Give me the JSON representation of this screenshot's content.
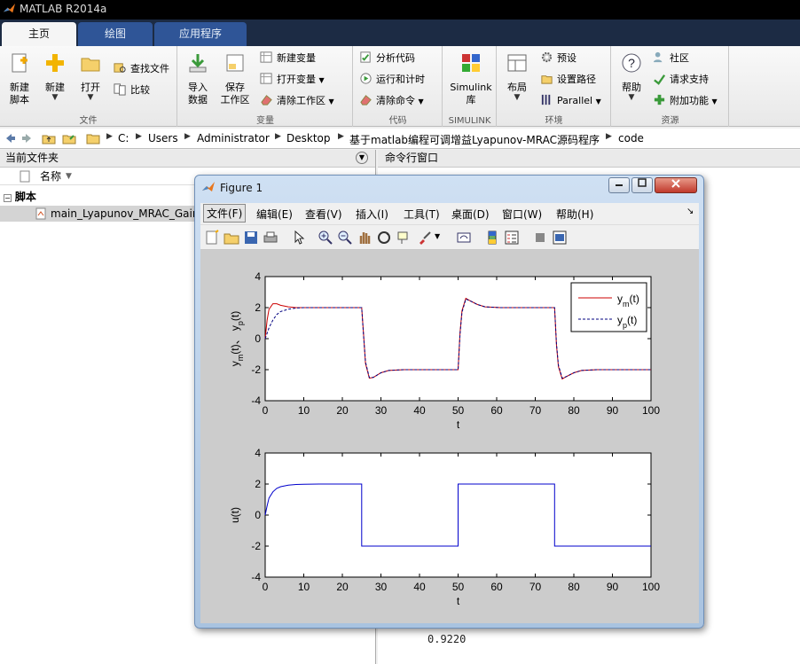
{
  "app": {
    "title": "MATLAB R2014a",
    "tabs": [
      {
        "label": "主页",
        "active": true
      },
      {
        "label": "绘图",
        "active": false
      },
      {
        "label": "应用程序",
        "active": false
      }
    ]
  },
  "ribbon": {
    "file": {
      "group_label": "文件",
      "new_script_line1": "新建",
      "new_script_line2": "脚本",
      "new_label": "新建",
      "open_label": "打开",
      "find_files": "查找文件",
      "compare": "比较"
    },
    "variable": {
      "group_label": "变量",
      "import_line1": "导入",
      "import_line2": "数据",
      "save_line1": "保存",
      "save_line2": "工作区",
      "new_variable": "新建变量",
      "open_variable": "打开变量",
      "clear_workspace": "清除工作区"
    },
    "code": {
      "group_label": "代码",
      "analyze": "分析代码",
      "run_time": "运行和计时",
      "clear_commands": "清除命令"
    },
    "simulink": {
      "group_label": "SIMULINK",
      "line1": "Simulink",
      "line2": "库"
    },
    "environment": {
      "group_label": "环境",
      "layout": "布局",
      "preferences": "预设",
      "set_path": "设置路径",
      "parallel": "Parallel"
    },
    "resources": {
      "group_label": "资源",
      "help": "帮助",
      "community": "社区",
      "support": "请求支持",
      "addons": "附加功能"
    }
  },
  "address": {
    "crumbs": [
      "C:",
      "Users",
      "Administrator",
      "Desktop",
      "基于matlab编程可调增益Lyapunov-MRAC源码程序",
      "code"
    ]
  },
  "current_folder": {
    "title": "当前文件夹",
    "column_name": "名称",
    "section": "脚本",
    "file": "main_Lyapunov_MRAC_Gain"
  },
  "command_window": {
    "title": "命令行窗口",
    "output_value": "0.9220"
  },
  "figure": {
    "title": "Figure 1",
    "menu": [
      "文件(F)",
      "编辑(E)",
      "查看(V)",
      "插入(I)",
      "工具(T)",
      "桌面(D)",
      "窗口(W)",
      "帮助(H)"
    ]
  },
  "chart_data": [
    {
      "type": "line",
      "xlabel": "t",
      "ylabel": "y_m(t)、 y_p(t)",
      "xlim": [
        0,
        100
      ],
      "ylim": [
        -4,
        4
      ],
      "xticks": [
        0,
        10,
        20,
        30,
        40,
        50,
        60,
        70,
        80,
        90,
        100
      ],
      "yticks": [
        -4,
        -2,
        0,
        2,
        4
      ],
      "legend_position": "top-right",
      "grid": false,
      "series": [
        {
          "name": "y_m(t)",
          "color": "#cc0000",
          "style": "solid",
          "x": [
            0,
            0.5,
            1,
            2,
            3,
            4,
            6,
            8,
            12,
            25,
            25.5,
            26,
            27,
            28,
            30,
            32,
            36,
            50,
            50.5,
            51,
            52,
            53,
            55,
            57,
            61,
            75,
            75.5,
            76,
            77,
            78,
            80,
            82,
            86,
            100
          ],
          "y": [
            0,
            1.2,
            1.9,
            2.25,
            2.25,
            2.15,
            2.05,
            2.0,
            2.0,
            2.0,
            0.3,
            -1.6,
            -2.55,
            -2.5,
            -2.2,
            -2.05,
            -2.0,
            -2.0,
            0.4,
            1.8,
            2.6,
            2.45,
            2.2,
            2.05,
            2.0,
            2.0,
            -0.4,
            -1.8,
            -2.6,
            -2.45,
            -2.2,
            -2.05,
            -2.0,
            -2.0
          ]
        },
        {
          "name": "y_p(t)",
          "color": "#000080",
          "style": "dashed",
          "x": [
            0,
            1,
            2,
            3,
            4,
            6,
            8,
            10,
            12,
            25,
            25.5,
            26,
            27,
            28,
            30,
            32,
            36,
            50,
            50.5,
            51,
            52,
            53,
            55,
            57,
            61,
            75,
            75.5,
            76,
            77,
            78,
            80,
            82,
            86,
            100
          ],
          "y": [
            0,
            0.7,
            1.2,
            1.55,
            1.75,
            1.9,
            1.97,
            2.0,
            2.0,
            2.0,
            0.2,
            -1.5,
            -2.5,
            -2.5,
            -2.2,
            -2.05,
            -2.0,
            -2.0,
            0.3,
            1.7,
            2.55,
            2.45,
            2.2,
            2.05,
            2.0,
            2.0,
            -0.3,
            -1.7,
            -2.55,
            -2.45,
            -2.2,
            -2.05,
            -2.0,
            -2.0
          ]
        }
      ]
    },
    {
      "type": "line",
      "xlabel": "t",
      "ylabel": "u(t)",
      "xlim": [
        0,
        100
      ],
      "ylim": [
        -4,
        4
      ],
      "xticks": [
        0,
        10,
        20,
        30,
        40,
        50,
        60,
        70,
        80,
        90,
        100
      ],
      "yticks": [
        -4,
        -2,
        0,
        2,
        4
      ],
      "grid": false,
      "series": [
        {
          "color": "#0000cc",
          "style": "solid",
          "x": [
            0,
            0.5,
            1,
            2,
            3,
            4,
            6,
            8,
            10,
            14,
            25,
            25,
            50,
            50,
            75,
            75,
            100
          ],
          "y": [
            0,
            0.6,
            1.1,
            1.5,
            1.72,
            1.83,
            1.93,
            1.97,
            1.99,
            2.0,
            2.0,
            -2.0,
            -2.0,
            2.0,
            2.0,
            -2.0,
            -2.0
          ]
        }
      ]
    }
  ]
}
